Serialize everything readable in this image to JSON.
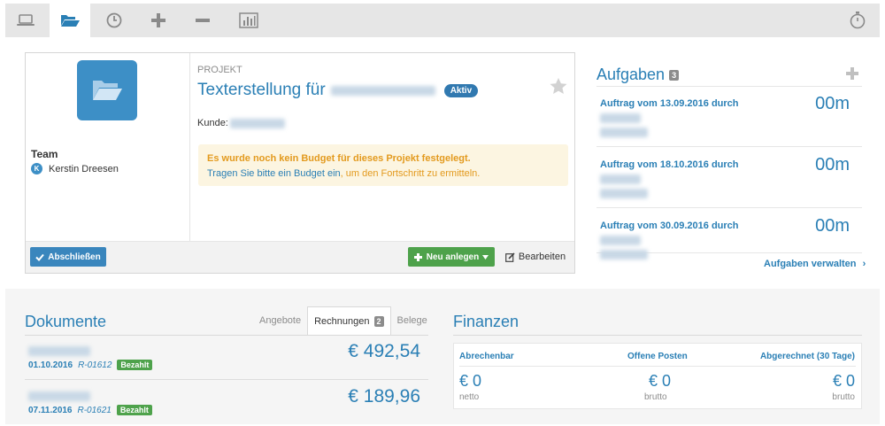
{
  "toolbar": {
    "items": [
      {
        "icon": "laptop-icon"
      },
      {
        "icon": "folder-open-icon",
        "active": true
      },
      {
        "icon": "clock-icon"
      },
      {
        "icon": "plus-icon"
      },
      {
        "icon": "minus-icon"
      },
      {
        "icon": "bar-chart-icon"
      },
      {
        "icon": "stopwatch-icon"
      }
    ]
  },
  "project": {
    "type_label": "PROJEKT",
    "title_prefix": "Texterstellung für",
    "status_badge": "Aktiv",
    "customer_label": "Kunde:",
    "team_label": "Team",
    "team_members": [
      {
        "initial": "K",
        "name": "Kerstin Dreesen"
      }
    ],
    "budget_alert": {
      "line1": "Es wurde noch kein Budget für dieses Projekt festgelegt.",
      "link": "Tragen Sie bitte ein Budget ein",
      "rest": ", um den Fortschritt zu ermitteln."
    },
    "close_button": "Abschließen",
    "new_button": "Neu anlegen",
    "edit_button": "Bearbeiten"
  },
  "tasks": {
    "title": "Aufgaben",
    "count": "3",
    "items": [
      {
        "text": "Auftrag vom 13.09.2016 durch",
        "duration": "00m"
      },
      {
        "text": "Auftrag vom 18.10.2016 durch",
        "duration": "00m"
      },
      {
        "text": "Auftrag vom 30.09.2016 durch",
        "duration": "00m"
      }
    ],
    "manage_link": "Aufgaben verwalten"
  },
  "documents": {
    "title": "Dokumente",
    "tabs": [
      {
        "label": "Angebote",
        "active": false
      },
      {
        "label": "Rechnungen",
        "count": "2",
        "active": true
      },
      {
        "label": "Belege",
        "active": false
      }
    ],
    "rows": [
      {
        "date": "01.10.2016",
        "number": "R-01612",
        "status": "Bezahlt",
        "amount": "€ 492,54"
      },
      {
        "date": "07.11.2016",
        "number": "R-01621",
        "status": "Bezahlt",
        "amount": "€ 189,96"
      }
    ]
  },
  "finances": {
    "title": "Finanzen",
    "columns": [
      {
        "label": "Abrechenbar",
        "value": "€ 0",
        "note": "netto"
      },
      {
        "label": "Offene Posten",
        "value": "€ 0",
        "note": "brutto"
      },
      {
        "label": "Abgerechnet (30 Tage)",
        "value": "€ 0",
        "note": "brutto"
      }
    ]
  },
  "colors": {
    "accent": "#2a7fb5",
    "success": "#4ea24b",
    "warning_text": "#e39a1e",
    "warning_bg": "#fcf5e1"
  }
}
